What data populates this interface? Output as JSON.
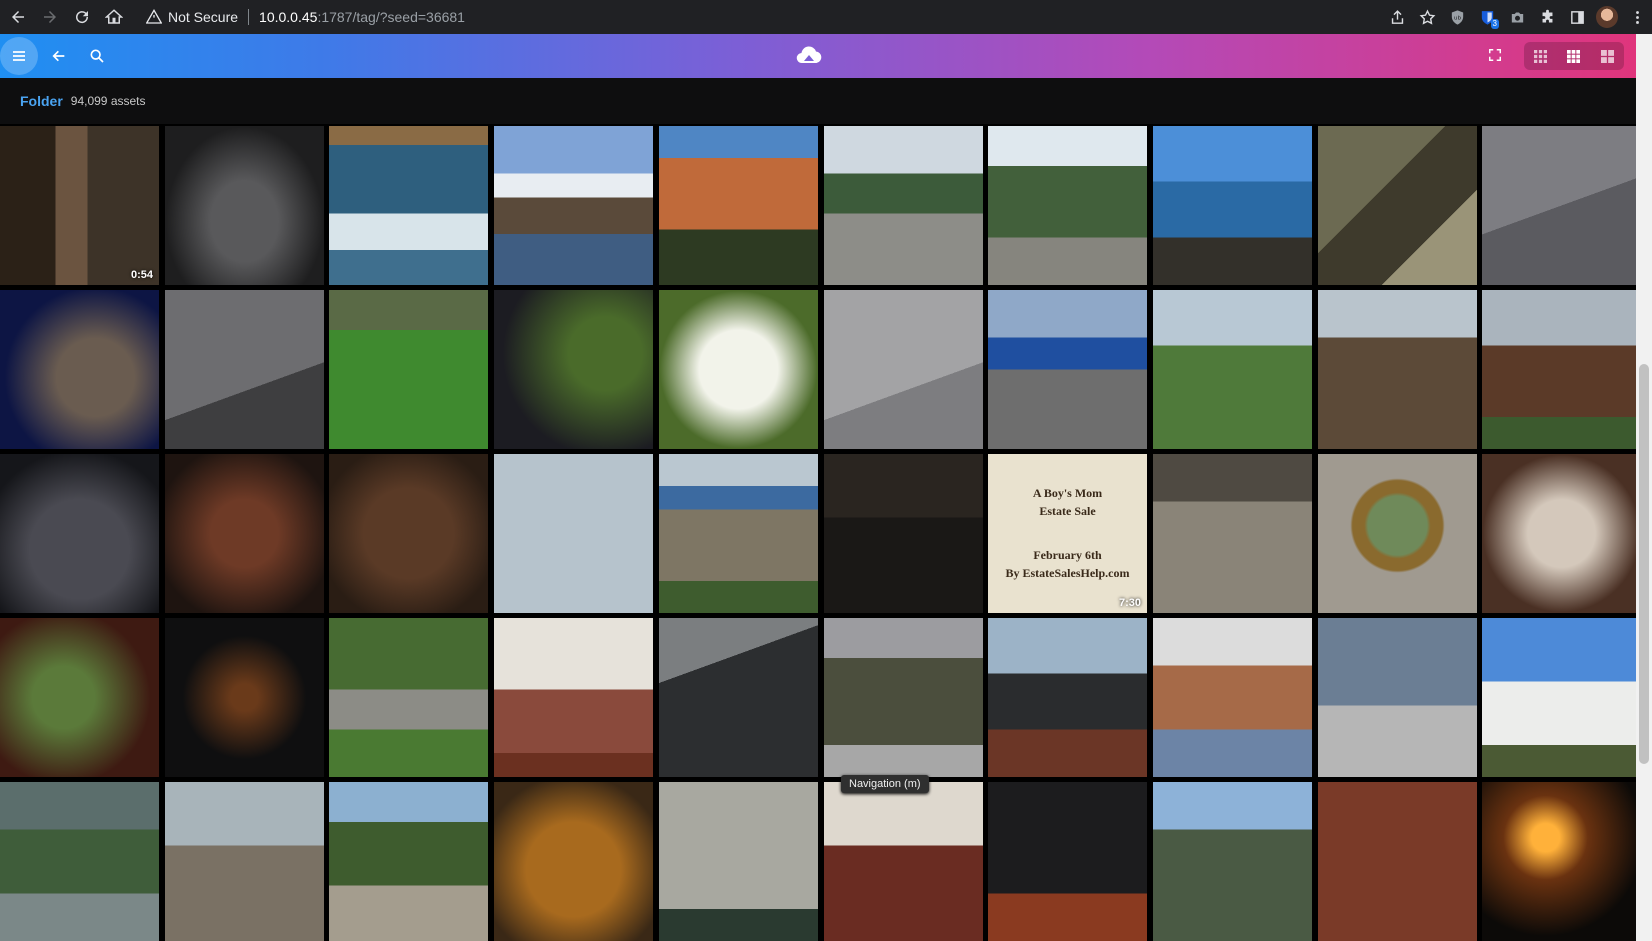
{
  "browser": {
    "security_label": "Not Secure",
    "url_host": "10.0.0.45",
    "url_path": ":1787/tag/?seed=36681",
    "extension_badge": "3"
  },
  "app": {
    "folder_title": "Folder",
    "asset_count": "94,099 assets",
    "tooltip": "Navigation   (m)"
  },
  "grid": {
    "rows": [
      [
        {
          "bg": "linear-gradient(90deg,#2b2117 0 35%,#6b5440 35% 55%,#3d3328 55% 100%)",
          "duration": "0:54"
        },
        {
          "bg": "radial-gradient(ellipse at 50% 60%,#59595b 0 30%,#1e1e1f 70%)"
        },
        {
          "bg": "linear-gradient(180deg,#8a6b45 0 12%,#2e5f7e 12% 55%,#d8e4ea 55% 78%,#3f6f8e 78%)"
        },
        {
          "bg": "linear-gradient(180deg,#7fa3d6 0 30%,#e8edf2 30% 45%,#5a4a3a 45% 68%,#3f5d82 68%)"
        },
        {
          "bg": "linear-gradient(180deg,#4f86c4 0 20%,#c06a3a 20% 65%,#2d3a22 65%)"
        },
        {
          "bg": "linear-gradient(180deg,#cfd8e0 0 30%,#3c5b3a 30% 55%,#8d8d88 55%)"
        },
        {
          "bg": "linear-gradient(180deg,#dfe8ee 0 25%,#42603b 25% 70%,#86857e 70%)"
        },
        {
          "bg": "linear-gradient(180deg,#4c8fd8 0 35%,#2a6aa5 35% 70%,#33302a 70%)"
        },
        {
          "bg": "linear-gradient(135deg,#6c6a52 0 40%,#3e3a2c 40% 70%,#9a9478 70%)"
        },
        {
          "bg": "linear-gradient(160deg,#7d7d82 0 50%,#5b5b60 50%)"
        }
      ],
      [
        {
          "bg": "radial-gradient(circle at 60% 55%,#6a5c50 0 30%,#0d1544 70%)"
        },
        {
          "bg": "linear-gradient(160deg,#6d6d70 0 60%,#3e3e40 60%)"
        },
        {
          "bg": "linear-gradient(180deg,#5a6a46 0 25%,#3f8a2f 25%)"
        },
        {
          "bg": "radial-gradient(circle at 70% 40%,#4a6b2a 0 25%,#1c1c22 70%)"
        },
        {
          "bg": "radial-gradient(circle at 50% 50%,#f2f3ea 0 35%,#4c6b2a 70%)"
        },
        {
          "bg": "linear-gradient(160deg,#a3a3a5 0 60%,#7d7d80 60%)"
        },
        {
          "bg": "linear-gradient(180deg,#8fa8c8 0 30%,#1f4fa0 30% 50%,#6e6e6e 50%)"
        },
        {
          "bg": "linear-gradient(180deg,#b8c8d4 0 35%,#4f7a3a 35%)"
        },
        {
          "bg": "linear-gradient(180deg,#b9c4cc 0 30%,#5c4a38 30%)"
        },
        {
          "bg": "linear-gradient(180deg,#aab4bd 0 35%,#5b3a28 35% 80%,#3c5a2e 80%)"
        }
      ],
      [
        {
          "bg": "radial-gradient(circle at 50% 60%,#4a4a52 0 40%,#15161a 80%)"
        },
        {
          "bg": "radial-gradient(circle at 50% 50%,#6e3a26 0 30%,#1e1410 80%)"
        },
        {
          "bg": "radial-gradient(circle at 50% 50%,#5a3a26 0 40%,#2a1d14 80%)"
        },
        {
          "bg": "linear-gradient(180deg,#b6c3cc 0 100%)"
        },
        {
          "bg": "linear-gradient(180deg,#bac7d0 0 20%,#3c6aa0 20% 35%,#7e7664 35% 80%,#3e5c2e 80%)"
        },
        {
          "bg": "linear-gradient(180deg,#2a2520 0 40%,#1a1816 40%)"
        },
        {
          "bg": "#e9e2cf",
          "duration": "7:30",
          "poster_top": "A Boy's Mom\nEstate Sale",
          "poster_bottom": "February 6th\nBy EstateSalesHelp.com"
        },
        {
          "bg": "linear-gradient(180deg,#4f4a42 0 30%,#8a8478 30%)"
        },
        {
          "bg": "radial-gradient(circle at 50% 45%,#6f8a5a 0 25%,#8a6a2e 28% 38%,#a09a90 40%)"
        },
        {
          "bg": "radial-gradient(circle at 50% 50%,#d4c8bb 0 30%,#4a3024 70%)"
        }
      ],
      [
        {
          "bg": "radial-gradient(circle at 40% 50%,#5b7a3a 0 25%,#3e1a12 70%)"
        },
        {
          "bg": "radial-gradient(circle at 50% 50%,#6a3a1a 0 12%,#0f0f10 55%)"
        },
        {
          "bg": "linear-gradient(180deg,#476b32 0 45%,#8c8c86 45% 70%,#4a7a32 70%)"
        },
        {
          "bg": "linear-gradient(180deg,#e6e2da 0 45%,#8a4a3c 45% 85%,#6b3020 85%)"
        },
        {
          "bg": "linear-gradient(160deg,#7b7e80 0 30%,#2c2e30 30%)"
        },
        {
          "bg": "linear-gradient(180deg,#9c9ca0 0 25%,#4b4e3d 25% 80%,#a7a7a7 80%)"
        },
        {
          "bg": "linear-gradient(180deg,#9cb3c7 0 35%,#2a2c2e 35% 70%,#6b3626 70%)"
        },
        {
          "bg": "linear-gradient(180deg,#dcdcdc 0 30%,#a66a48 30% 70%,#6c84a6 70%)"
        },
        {
          "bg": "linear-gradient(180deg,#6b7e94 0 55%,#b6b6b6 55%)"
        },
        {
          "bg": "linear-gradient(180deg,#4d8ad8 0 40%,#ecedeb 40% 80%,#4b5a34 80%)"
        }
      ],
      [
        {
          "bg": "linear-gradient(180deg,#5b6e6c 0 30%,#3f5d3a 30% 70%,#7b8888 70%)"
        },
        {
          "bg": "linear-gradient(180deg,#a8b4ba 0 40%,#7a7164 40%)"
        },
        {
          "bg": "linear-gradient(180deg,#8cb0d0 0 25%,#3e5c2e 25% 65%,#a49d8e 65%)"
        },
        {
          "bg": "radial-gradient(circle at 50% 55%,#a86a1e 0 40%,#3a2816 80%)"
        },
        {
          "bg": "linear-gradient(180deg,#a8a8a0 0 80%,#2a3a30 80%)"
        },
        {
          "bg": "linear-gradient(180deg,#ded8ce 0 40%,#6a2c22 40%)"
        },
        {
          "bg": "linear-gradient(180deg,#1c1c1e 0 70%,#8a3a20 70%)"
        },
        {
          "bg": "linear-gradient(180deg,#8db2d8 0 30%,#4a5a44 30%)"
        },
        {
          "bg": "linear-gradient(180deg,#7a3a28 0 100%)"
        },
        {
          "bg": "radial-gradient(circle at 40% 35%,#ffb13a 0 10%,#6a3210 30%,#0c0a08 70%)"
        }
      ]
    ]
  }
}
